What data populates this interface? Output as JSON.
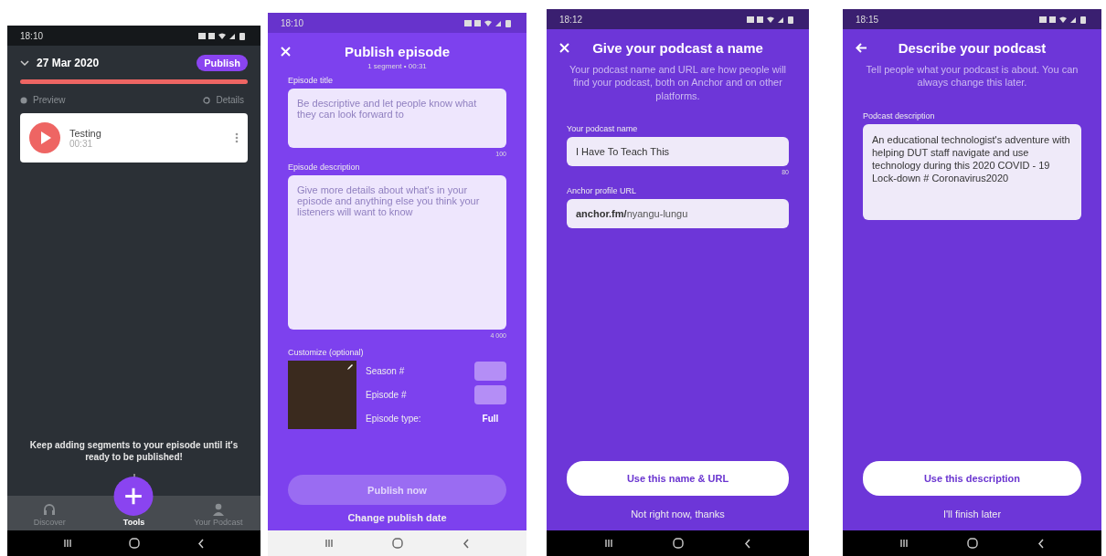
{
  "screens": [
    {
      "kind": "episode",
      "status_time": "18:10",
      "date": "27 Mar 2020",
      "publish_button": "Publish",
      "preview": "Preview",
      "details": "Details",
      "segments": [
        {
          "title": "Testing",
          "duration": "00:31"
        }
      ],
      "hint": "Keep adding segments to your episode until it's ready to be published!",
      "bottom_tabs": [
        {
          "label": "Discover",
          "selected": false
        },
        {
          "label": "Tools",
          "selected": true
        },
        {
          "label": "Your Podcast",
          "selected": false
        }
      ]
    },
    {
      "kind": "publish",
      "status_time": "18:10",
      "header_icon": {
        "kind": "close"
      },
      "title": "Publish episode",
      "subtitle": "1 segment • 00:31",
      "fields": [
        {
          "kind": "input",
          "label": "Episode title",
          "placeholder": "Be descriptive and let people know what they can look forward to",
          "counter": "100"
        },
        {
          "kind": "textarea",
          "label": "Episode description",
          "placeholder": "Give more details about what's in your episode and anything else you think your listeners will want to know",
          "counter": "4 000"
        }
      ],
      "customize": "Customize (optional)",
      "options": [
        {
          "kind": "input",
          "label": "Season #"
        },
        {
          "kind": "input",
          "label": "Episode #"
        },
        {
          "kind": "value",
          "label": "Episode type:",
          "value": "Full"
        }
      ],
      "primary": {
        "label": "Publish now",
        "disabled": true
      },
      "secondary": "Change publish date"
    },
    {
      "kind": "form",
      "status_time": "18:12",
      "header_icon": {
        "kind": "close"
      },
      "title": "Give your podcast a name",
      "intro": "Your podcast name and URL are how people will find your podcast, both on Anchor and on other platforms.",
      "fields": [
        {
          "kind": "input",
          "label": "Your podcast name",
          "value": "I Have To Teach This",
          "counter": "80"
        },
        {
          "kind": "url",
          "label": "Anchor profile URL",
          "prefix": "anchor.fm/",
          "value": "nyangu-lungu"
        }
      ],
      "primary": {
        "label": "Use this name & URL",
        "disabled": false
      },
      "secondary": "Not right now, thanks"
    },
    {
      "kind": "form",
      "status_time": "18:15",
      "header_icon": {
        "kind": "back"
      },
      "title": "Describe your podcast",
      "intro": "Tell people what your podcast is about. You can always change this later.",
      "fields": [
        {
          "kind": "textarea",
          "label": "Podcast description",
          "value": "An educational technologist's adventure with helping DUT staff navigate and use technology during this 2020 COVID - 19 Lock-down # Coronavirus2020"
        }
      ],
      "primary": {
        "label": "Use this description",
        "disabled": false
      },
      "secondary": "I'll finish later"
    }
  ]
}
